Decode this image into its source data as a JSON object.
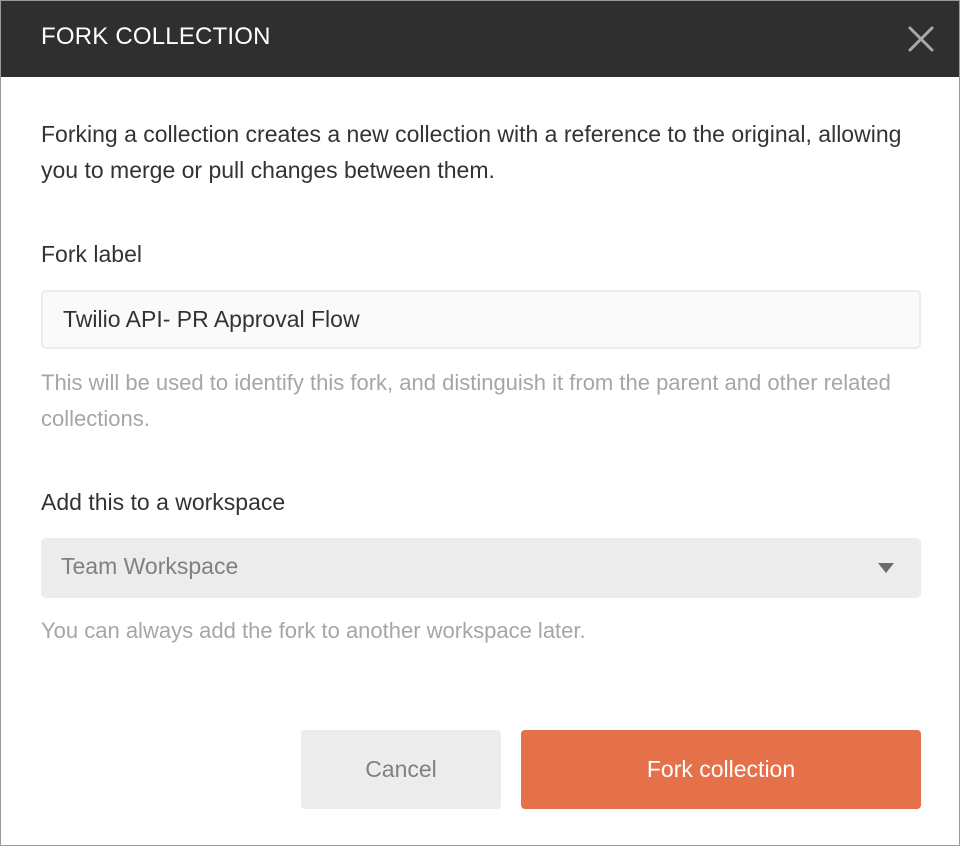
{
  "header": {
    "title": "FORK COLLECTION",
    "close_icon": "close-icon"
  },
  "description": "Forking a collection creates a new collection with a reference to the original, allowing you to merge or pull changes between them.",
  "fork_label": {
    "label": "Fork label",
    "value": "Twilio API- PR Approval Flow",
    "help": "This will be used to identify this fork, and distinguish it from the parent and other related collections."
  },
  "workspace": {
    "label": "Add this to a workspace",
    "selected": "Team Workspace",
    "caret_icon": "caret-down-icon",
    "help": "You can always add the fork to another workspace later."
  },
  "actions": {
    "cancel_label": "Cancel",
    "submit_label": "Fork collection"
  },
  "colors": {
    "header_bg": "#2f2f2f",
    "primary": "#e4714a",
    "secondary_bg": "#ececec",
    "help_text": "#a6a6a6",
    "body_text": "#333333"
  }
}
